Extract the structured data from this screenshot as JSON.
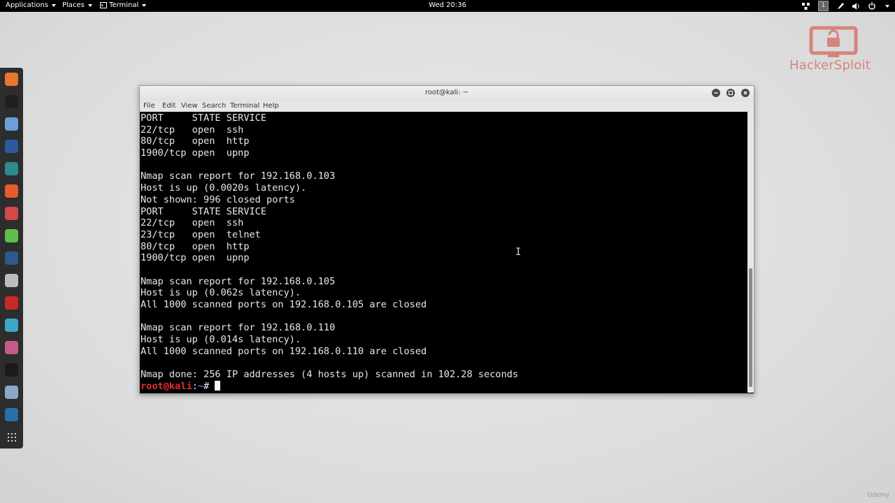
{
  "topbar": {
    "applications": "Applications",
    "places": "Places",
    "terminal": "Terminal",
    "clock": "Wed 20:36",
    "workspace": "1"
  },
  "logo": {
    "text": "HackerSploit"
  },
  "window": {
    "title": "root@kali: ~",
    "menu": [
      "File",
      "Edit",
      "View",
      "Search",
      "Terminal",
      "Help"
    ]
  },
  "terminal": {
    "lines": [
      "PORT     STATE SERVICE",
      "22/tcp   open  ssh",
      "80/tcp   open  http",
      "1900/tcp open  upnp",
      "",
      "Nmap scan report for 192.168.0.103",
      "Host is up (0.0020s latency).",
      "Not shown: 996 closed ports",
      "PORT     STATE SERVICE",
      "22/tcp   open  ssh",
      "23/tcp   open  telnet",
      "80/tcp   open  http",
      "1900/tcp open  upnp",
      "",
      "Nmap scan report for 192.168.0.105",
      "Host is up (0.062s latency).",
      "All 1000 scanned ports on 192.168.0.105 are closed",
      "",
      "Nmap scan report for 192.168.0.110",
      "Host is up (0.014s latency).",
      "All 1000 scanned ports on 192.168.0.110 are closed",
      "",
      "Nmap done: 256 IP addresses (4 hosts up) scanned in 102.28 seconds"
    ],
    "prompt_user": "root@kali",
    "prompt_sep": ":",
    "prompt_path": "~",
    "prompt_symbol": "# "
  },
  "dock": {
    "icons": [
      {
        "name": "firefox-icon",
        "color": "#e8762b"
      },
      {
        "name": "terminal-icon",
        "color": "#1f1f1f"
      },
      {
        "name": "files-icon",
        "color": "#6a9fd8"
      },
      {
        "name": "metasploit-icon",
        "color": "#2c5a9c"
      },
      {
        "name": "armitage-icon",
        "color": "#2f8a8a"
      },
      {
        "name": "burpsuite-icon",
        "color": "#e65c2c"
      },
      {
        "name": "maltego-icon",
        "color": "#d04a4a"
      },
      {
        "name": "notes-icon",
        "color": "#5fbf4a"
      },
      {
        "name": "kali-dragon-icon",
        "color": "#2c5a8a"
      },
      {
        "name": "keyboard-icon",
        "color": "#bdbdbd"
      },
      {
        "name": "faraday-icon",
        "color": "#c92828"
      },
      {
        "name": "eye-icon",
        "color": "#3fa8c8"
      },
      {
        "name": "toggle-icon",
        "color": "#c85a8a"
      },
      {
        "name": "anonymous-icon",
        "color": "#1a1a1a"
      },
      {
        "name": "alien-icon",
        "color": "#8aa8c8"
      },
      {
        "name": "wordpress-icon",
        "color": "#2a6fa8"
      },
      {
        "name": "show-apps-icon",
        "color": "#2d2d2d"
      }
    ]
  },
  "watermark": "Udemy"
}
